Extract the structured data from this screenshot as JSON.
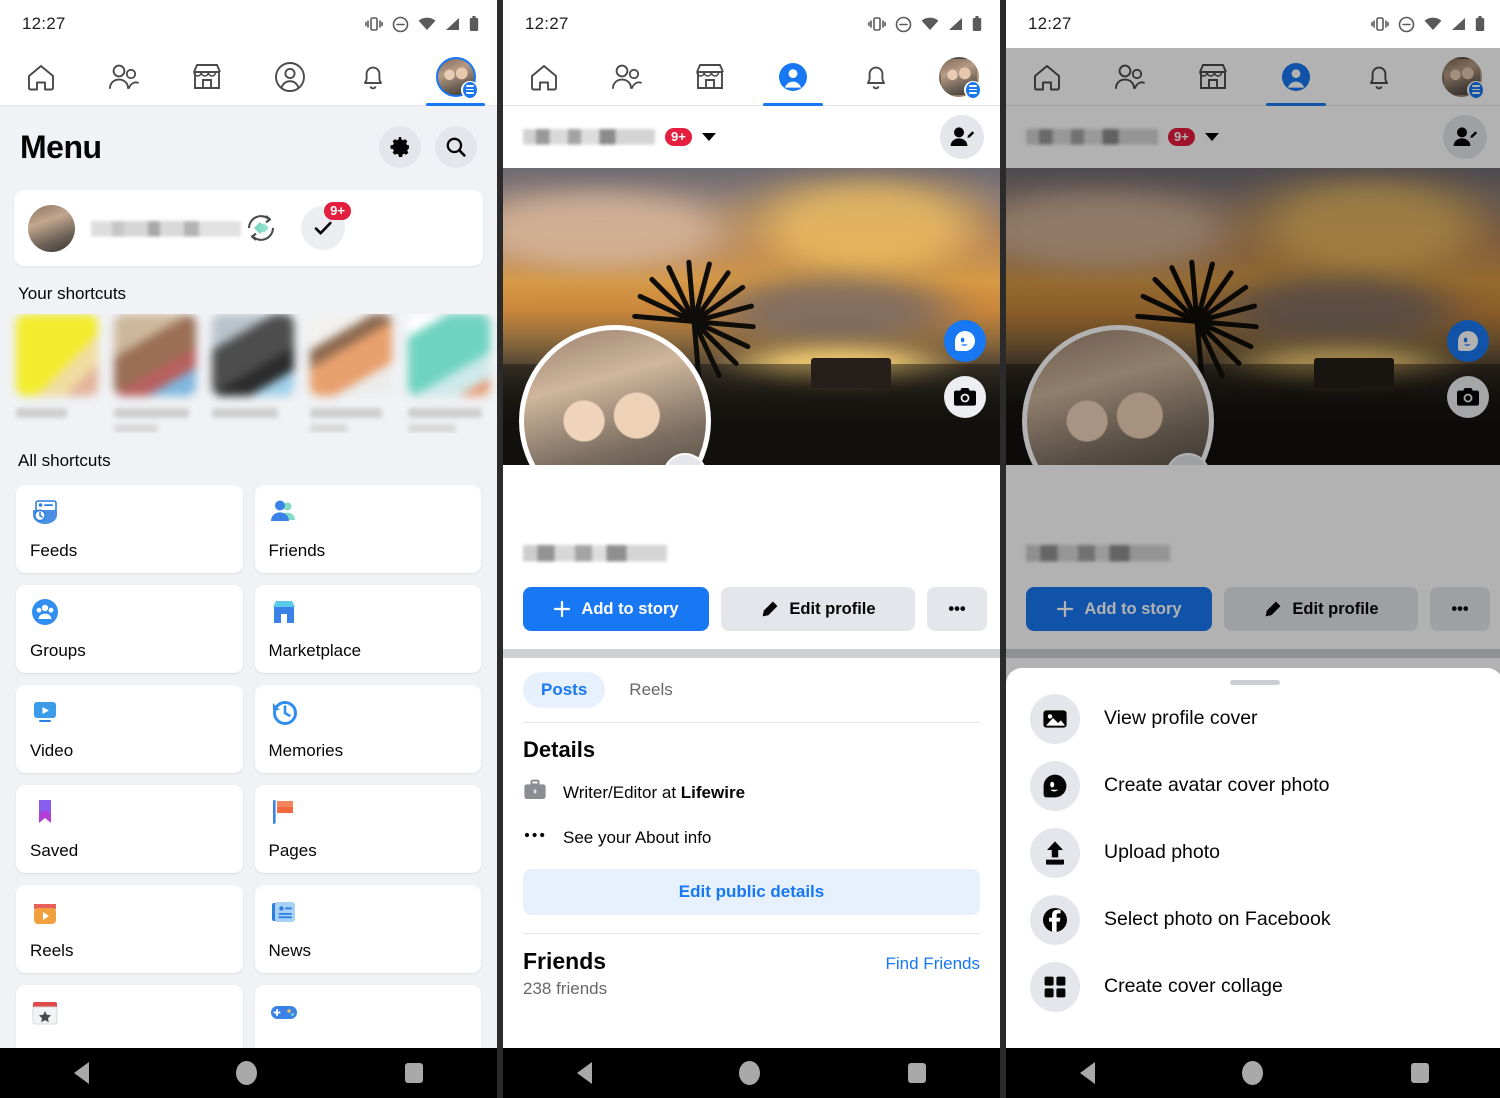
{
  "status_bar": {
    "time": "12:27",
    "icons": [
      "vibrate-icon",
      "do-not-disturb-icon",
      "wifi-icon",
      "cellular-icon",
      "battery-icon"
    ]
  },
  "top_nav": {
    "tabs": [
      {
        "name": "home",
        "icon": "home-icon",
        "active": false
      },
      {
        "name": "friends",
        "icon": "friends-icon",
        "active": false
      },
      {
        "name": "marketplace",
        "icon": "marketplace-icon",
        "active": false
      },
      {
        "name": "profile",
        "icon": "profile-circle-icon",
        "active": false
      },
      {
        "name": "notifications",
        "icon": "bell-icon",
        "active": false
      },
      {
        "name": "menu",
        "icon": "avatar-menu-icon",
        "active": true
      }
    ]
  },
  "panel1": {
    "title": "Menu",
    "header_buttons": [
      {
        "name": "settings",
        "icon": "gear-icon"
      },
      {
        "name": "search",
        "icon": "search-icon"
      }
    ],
    "profile_card": {
      "name_redacted": true,
      "sync_icon": "sync-icon",
      "check_icon": "check-icon",
      "badge": "9+"
    },
    "your_shortcuts_label": "Your shortcuts",
    "your_shortcuts": [
      {
        "name": "shortcut-1",
        "color": "#e8e22a"
      },
      {
        "name": "shortcut-2",
        "color": "#b39278"
      },
      {
        "name": "shortcut-3",
        "color": "#8d9aa3"
      },
      {
        "name": "shortcut-4",
        "color": "#e2ded9"
      },
      {
        "name": "shortcut-5",
        "color": "#6fd4c3"
      }
    ],
    "all_shortcuts_label": "All shortcuts",
    "all_shortcuts": [
      {
        "label": "Feeds",
        "icon": "feeds-icon"
      },
      {
        "label": "Friends",
        "icon": "friends-color-icon"
      },
      {
        "label": "Groups",
        "icon": "groups-icon"
      },
      {
        "label": "Marketplace",
        "icon": "marketplace-color-icon"
      },
      {
        "label": "Video",
        "icon": "video-icon"
      },
      {
        "label": "Memories",
        "icon": "memories-icon"
      },
      {
        "label": "Saved",
        "icon": "saved-bookmark-icon"
      },
      {
        "label": "Pages",
        "icon": "pages-flag-icon"
      },
      {
        "label": "Reels",
        "icon": "reels-icon"
      },
      {
        "label": "News",
        "icon": "news-icon"
      },
      {
        "label": "",
        "icon": "events-calendar-icon"
      },
      {
        "label": "",
        "icon": "gaming-controller-icon"
      }
    ]
  },
  "panel2": {
    "header": {
      "name_redacted": true,
      "badge": "9+",
      "caret_icon": "chevron-down-icon",
      "add_friend_icon": "add-friend-icon"
    },
    "cover": {
      "description": "sunset cover photo",
      "avatar_fab_icon": "avatar-icon",
      "camera_fab_icon": "camera-icon",
      "profile_photo_camera_icon": "camera-icon"
    },
    "actions": [
      {
        "label": "Add to story",
        "icon": "plus-icon",
        "style": "primary"
      },
      {
        "label": "Edit profile",
        "icon": "pencil-icon",
        "style": "neutral"
      },
      {
        "label": "•••",
        "icon": "more-icon",
        "style": "dots"
      }
    ],
    "tabs": [
      {
        "label": "Posts",
        "active": true
      },
      {
        "label": "Reels",
        "active": false
      }
    ],
    "details": {
      "heading": "Details",
      "rows": [
        {
          "icon": "briefcase-icon",
          "prefix": "Writer/Editor at ",
          "strong": "Lifewire"
        },
        {
          "icon": "more-dots-icon",
          "prefix": "See your About info",
          "strong": ""
        }
      ],
      "edit_button": "Edit public details"
    },
    "friends": {
      "heading": "Friends",
      "action": "Find Friends",
      "count": "238 friends"
    }
  },
  "panel3": {
    "sheet_items": [
      {
        "label": "View profile cover",
        "icon": "image-icon"
      },
      {
        "label": "Create avatar cover photo",
        "icon": "avatar-icon"
      },
      {
        "label": "Upload photo",
        "icon": "upload-icon"
      },
      {
        "label": "Select photo on Facebook",
        "icon": "facebook-icon"
      },
      {
        "label": "Create cover collage",
        "icon": "grid-icon"
      }
    ],
    "grabber": "drag-handle"
  },
  "android_nav": {
    "back": "back-icon",
    "home": "home-circle-icon",
    "recents": "recents-square-icon"
  },
  "colors": {
    "brand_blue": "#1877f2",
    "badge_red": "#e41e3f",
    "surface_gray": "#f0f2f5",
    "chip_gray": "#e4e6eb"
  }
}
